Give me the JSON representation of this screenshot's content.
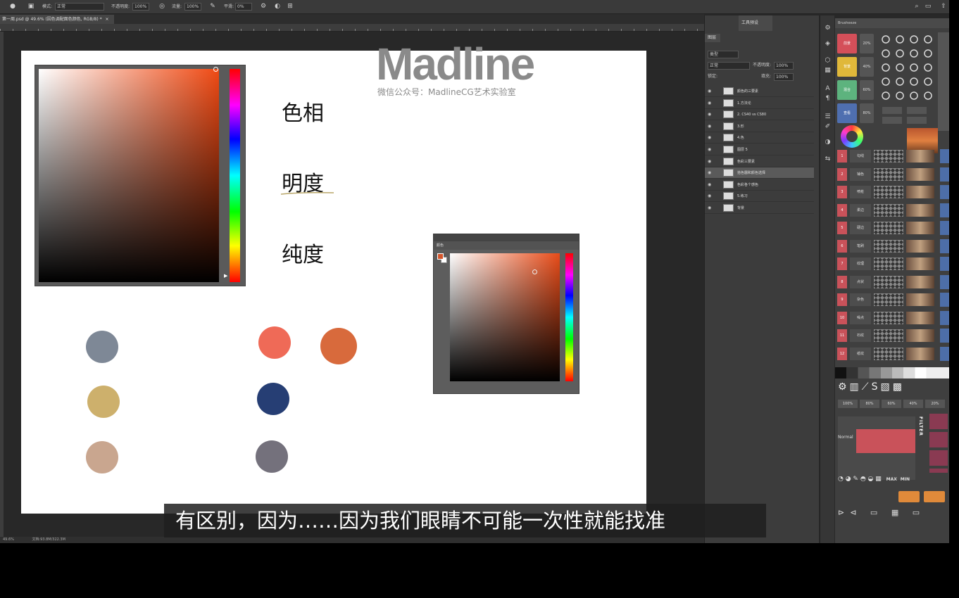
{
  "options_bar": {
    "mode_label": "模式:",
    "mode_value": "正常",
    "opacity_label": "不透明度:",
    "opacity_value": "100%",
    "flow_label": "流量:",
    "flow_value": "100%",
    "smoothing_label": "平滑:",
    "smoothing_value": "0%"
  },
  "document_tab": {
    "title": "第一周.psd @ 49.6% (因色调配面色颜色, RGB/8) *",
    "close": "×"
  },
  "canvas": {
    "terms": [
      "色相",
      "明度",
      "纯度"
    ],
    "logo_wordmark": "Madline",
    "logo_subtitle": "微信公众号：MadlineCG艺术实验室",
    "swatches": [
      {
        "name": "slate-gray",
        "color": "#7e8896"
      },
      {
        "name": "mustard",
        "color": "#cdb06c"
      },
      {
        "name": "tan",
        "color": "#c9a68f"
      },
      {
        "name": "coral",
        "color": "#ef6a57"
      },
      {
        "name": "orange",
        "color": "#d86a3c"
      },
      {
        "name": "navy",
        "color": "#263e74"
      },
      {
        "name": "purple-gray",
        "color": "#74717c"
      }
    ]
  },
  "color_panel": {
    "title": "颜色"
  },
  "status_bar": {
    "zoom": "49.6%",
    "doc_info": "文档:93.8M/322.3M"
  },
  "layers_panel": {
    "tabs": [
      "图层",
      "工具预设"
    ],
    "kind_label": "类型",
    "blend_mode": "正常",
    "opacity_label": "不透明度:",
    "opacity_value": "100%",
    "lock_label": "锁定:",
    "fill_label": "填充:",
    "fill_value": "100%",
    "layers": [
      {
        "name": "颜色的三要素"
      },
      {
        "name": "1.方法论"
      },
      {
        "name": "2. CS40 vs CS80"
      },
      {
        "name": "3.形"
      },
      {
        "name": "4.色"
      },
      {
        "name": "图层 5"
      },
      {
        "name": "色彩三要素"
      },
      {
        "name": "拾色器和颜色选择"
      },
      {
        "name": "色彩各个感色"
      },
      {
        "name": "5.练习"
      },
      {
        "name": "背景"
      }
    ]
  },
  "brush_panel": {
    "title": "Brusheeze",
    "color_buttons": [
      {
        "label": "前景",
        "color": "#d44f59"
      },
      {
        "label": "背景",
        "color": "#e0b83a"
      },
      {
        "label": "混合",
        "color": "#5db37e"
      },
      {
        "label": "查看",
        "color": "#4f6fb0"
      }
    ],
    "percent_labels": [
      "20%",
      "40%",
      "60%",
      "80%"
    ],
    "brush_labels": [
      "勾线",
      "铺色",
      "喷枪",
      "柔边",
      "硬边",
      "笔刷",
      "纹理",
      "点状",
      "杂色",
      "噪点",
      "石纹",
      "纸纹"
    ],
    "opacity_steps": [
      "100%",
      "80%",
      "60%",
      "40%",
      "20%"
    ],
    "filter_label": "FILTER",
    "normal_label": "Normal",
    "max_label": "MAX",
    "min_label": "MIN"
  },
  "subtitle": {
    "text": "有区别，因为……因为我们眼睛不可能一次性就能找准"
  }
}
